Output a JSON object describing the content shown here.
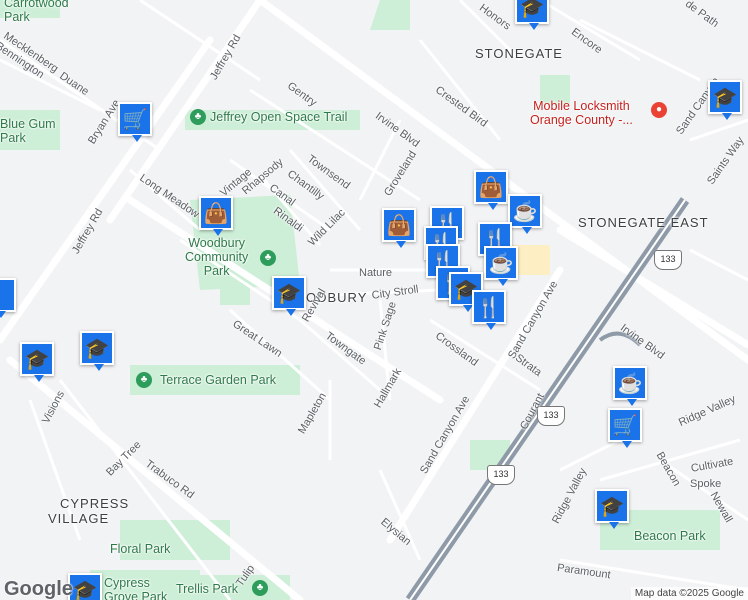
{
  "attribution": "Map data ©2025 Google",
  "logo": "Google",
  "colors": {
    "background": "#f2f3f4",
    "road": "#ffffff",
    "freeway": "#8e9aa8",
    "park": "#cdeed7",
    "marker": "#1a73e8",
    "poi_red": "#c5221f",
    "park_text": "#2f7a4a"
  },
  "neighborhoods": {
    "stonegate": "STONEGATE",
    "stonegate_east": "STONEGATE EAST",
    "woodbury": "ODBURY",
    "cypress_village_1": "CYPRESS",
    "cypress_village_2": "VILLAGE"
  },
  "parks": {
    "carrotwood": "Carrotwood\nPark",
    "jeffrey_open_space": "Jeffrey Open Space Trail",
    "woodbury_community": "Woodbury\nCommunity\nPark",
    "terrace_garden": "Terrace Garden Park",
    "blue_gum": "Blue Gum\nPark",
    "floral": "Floral Park",
    "cypress_grove": "Cypress\nGrove Park",
    "trellis": "Trellis Park",
    "beacon": "Beacon Park"
  },
  "business": {
    "name": "Mobile Locksmith\nOrange County -..."
  },
  "highway_shield": "133",
  "streets": {
    "jeffrey_rd": "Jeffrey Rd",
    "bryan_ave": "Bryan Ave",
    "irvine_blvd": "Irvine Blvd",
    "trabuco_rd": "Trabuco Rd",
    "sand_canyon_ave": "Sand Canyon Ave",
    "mecklenberg": "Mecklenberg",
    "bennington": "Bennington",
    "duane": "Duane",
    "gentry": "Gentry",
    "townsend": "Townsend",
    "chantilly": "Chantilly",
    "rhapsody": "Rhapsody",
    "vintage": "Vintage",
    "canal": "Canal",
    "rinaldi": "Rinaldi",
    "wild_lilac": "Wild Lilac",
    "long_meadow": "Long Meadow",
    "groveland": "Groveland",
    "crested_bird": "Crested Bird",
    "honors": "Honors",
    "encore": "Encore",
    "nature": "Nature",
    "city_stroll": "City Stroll",
    "pink_sage": "Pink Sage",
    "towngate": "Towngate",
    "revival": "Revival",
    "great_lawn": "Great Lawn",
    "hallmark": "Hallmark",
    "crossland": "Crossland",
    "strata": "Strata",
    "courant": "Courant",
    "mapleton": "Mapleton",
    "visions": "Visions",
    "bay_tree": "Bay Tree",
    "tulip": "Tulip",
    "elysian": "Elysian",
    "ridge_valley": "Ridge Valley",
    "beacon": "Beacon",
    "cultivate": "Cultivate",
    "spoke": "Spoke",
    "newall": "Newall",
    "paramount": "Paramount",
    "saints_way": "Saints Way",
    "sand_canyon_2": "Sand Canyon",
    "ridge_valley_2": "Ridge Valley",
    "irvine_blvd_2": "Irvine Blvd",
    "de_path": "de Path",
    "marks": "Hallmark",
    "ave": "Ave"
  },
  "markers": [
    {
      "icon": "cart-icon",
      "glyph": "🛒"
    },
    {
      "icon": "bag-icon",
      "glyph": "👜"
    },
    {
      "icon": "school-icon",
      "glyph": "🎓"
    },
    {
      "icon": "cup-icon",
      "glyph": "☕"
    },
    {
      "icon": "fork-knife-icon",
      "glyph": "🍴"
    }
  ]
}
